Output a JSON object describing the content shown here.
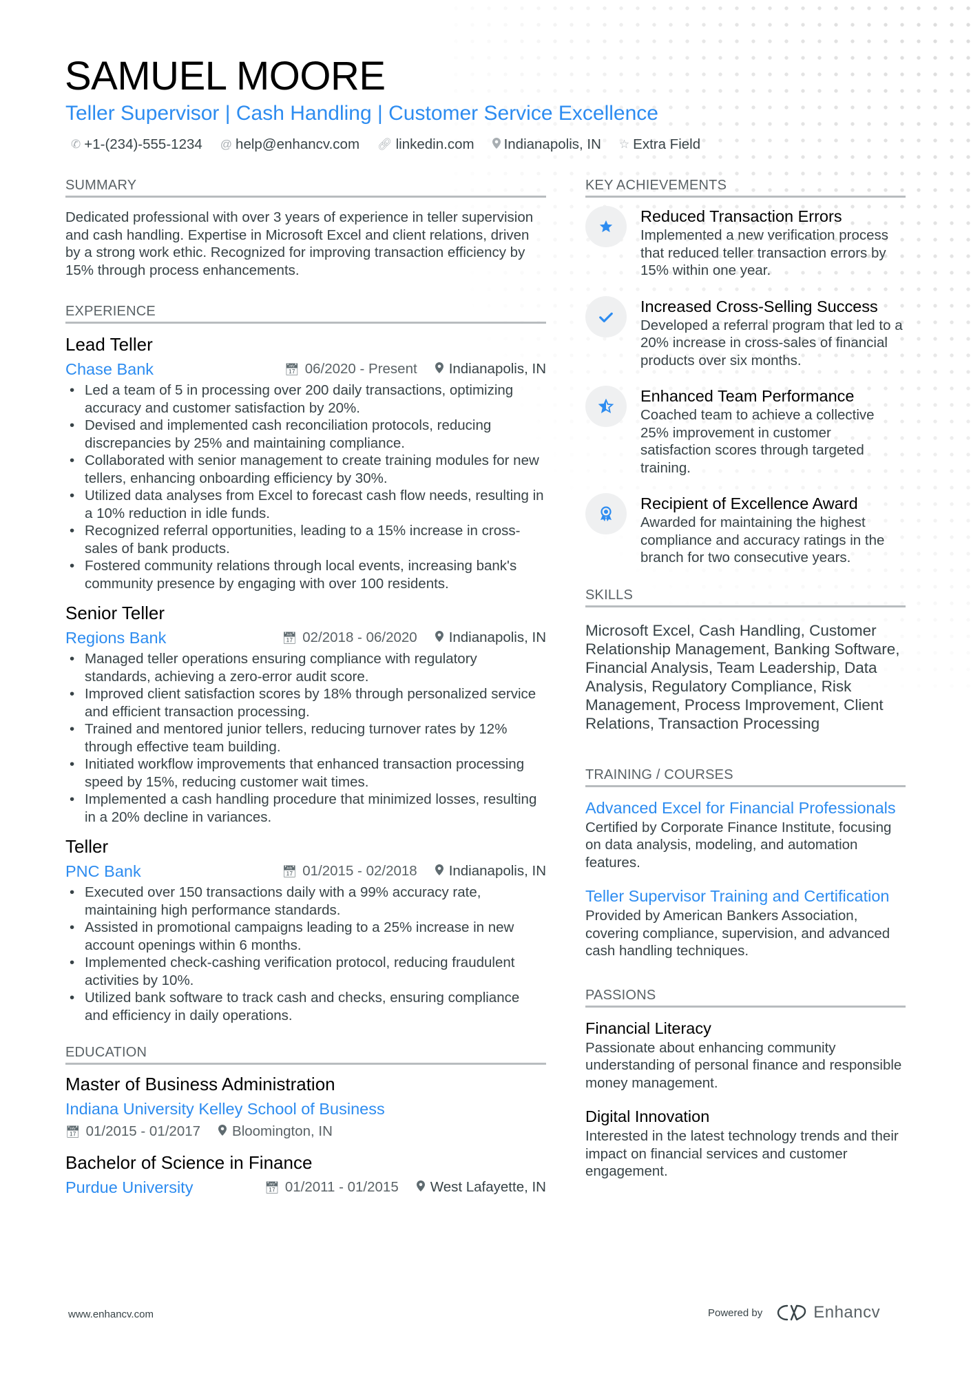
{
  "header": {
    "name": "SAMUEL MOORE",
    "title": "Teller Supervisor | Cash Handling | Customer Service Excellence",
    "contacts": [
      {
        "icon": "phone-icon",
        "text": "+1-(234)-555-1234"
      },
      {
        "icon": "at-icon",
        "text": "help@enhancv.com"
      },
      {
        "icon": "link-icon",
        "text": "linkedin.com"
      },
      {
        "icon": "location-icon",
        "text": "Indianapolis, IN"
      },
      {
        "icon": "star-icon",
        "text": "Extra Field"
      }
    ]
  },
  "summary": {
    "heading": "SUMMARY",
    "text": "Dedicated professional with over 3 years of experience in teller supervision and cash handling. Expertise in Microsoft Excel and client relations, driven by a strong work ethic. Recognized for improving transaction efficiency by 15% through process enhancements."
  },
  "experience": {
    "heading": "EXPERIENCE",
    "jobs": [
      {
        "title": "Lead Teller",
        "company": "Chase Bank",
        "dates": "06/2020 - Present",
        "location": "Indianapolis, IN",
        "bullets": [
          "Led a team of 5 in processing over 200 daily transactions, optimizing accuracy and customer satisfaction by 20%.",
          "Devised and implemented cash reconciliation protocols, reducing discrepancies by 25% and maintaining compliance.",
          "Collaborated with senior management to create training modules for new tellers, enhancing onboarding efficiency by 30%.",
          "Utilized data analyses from Excel to forecast cash flow needs, resulting in a 10% reduction in idle funds.",
          "Recognized referral opportunities, leading to a 15% increase in cross-sales of bank products.",
          "Fostered community relations through local events, increasing bank's community presence by engaging with over 100 residents."
        ]
      },
      {
        "title": "Senior Teller",
        "company": "Regions Bank",
        "dates": "02/2018 - 06/2020",
        "location": "Indianapolis, IN",
        "bullets": [
          "Managed teller operations ensuring compliance with regulatory standards, achieving a zero-error audit score.",
          "Improved client satisfaction scores by 18% through personalized service and efficient transaction processing.",
          "Trained and mentored junior tellers, reducing turnover rates by 12% through effective team building.",
          "Initiated workflow improvements that enhanced transaction processing speed by 15%, reducing customer wait times.",
          "Implemented a cash handling procedure that minimized losses, resulting in a 20% decline in variances."
        ]
      },
      {
        "title": "Teller",
        "company": "PNC Bank",
        "dates": "01/2015 - 02/2018",
        "location": "Indianapolis, IN",
        "bullets": [
          "Executed over 150 transactions daily with a 99% accuracy rate, maintaining high performance standards.",
          "Assisted in promotional campaigns leading to a 25% increase in new account openings within 6 months.",
          "Implemented check-cashing verification protocol, reducing fraudulent activities by 10%.",
          "Utilized bank software to track cash and checks, ensuring compliance and efficiency in daily operations."
        ]
      }
    ]
  },
  "education": {
    "heading": "EDUCATION",
    "items": [
      {
        "degree": "Master of Business Administration",
        "school": "Indiana University Kelley School of Business",
        "dates": "01/2015 - 01/2017",
        "location": "Bloomington, IN"
      },
      {
        "degree": "Bachelor of Science in Finance",
        "school": "Purdue University",
        "dates": "01/2011 - 01/2015",
        "location": "West Lafayette, IN"
      }
    ]
  },
  "achievements": {
    "heading": "KEY ACHIEVEMENTS",
    "items": [
      {
        "icon": "star-icon",
        "title": "Reduced Transaction Errors",
        "desc": "Implemented a new verification process that reduced teller transaction errors by 15% within one year."
      },
      {
        "icon": "check-icon",
        "title": "Increased Cross-Selling Success",
        "desc": "Developed a referral program that led to a 20% increase in cross-sales of financial products over six months."
      },
      {
        "icon": "half-star-icon",
        "title": "Enhanced Team Performance",
        "desc": "Coached team to achieve a collective 25% improvement in customer satisfaction scores through targeted training."
      },
      {
        "icon": "award-ribbon-icon",
        "title": "Recipient of Excellence Award",
        "desc": "Awarded for maintaining the highest compliance and accuracy ratings in the branch for two consecutive years."
      }
    ]
  },
  "skills": {
    "heading": "SKILLS",
    "text": "Microsoft Excel, Cash Handling, Customer Relationship Management, Banking Software, Financial Analysis, Team Leadership, Data Analysis, Regulatory Compliance, Risk Management, Process Improvement, Client Relations, Transaction Processing"
  },
  "training": {
    "heading": "TRAINING / COURSES",
    "items": [
      {
        "title": "Advanced Excel for Financial Professionals",
        "desc": "Certified by Corporate Finance Institute, focusing on data analysis, modeling, and automation features."
      },
      {
        "title": "Teller Supervisor Training and Certification",
        "desc": "Provided by American Bankers Association, covering compliance, supervision, and advanced cash handling techniques."
      }
    ]
  },
  "passions": {
    "heading": "PASSIONS",
    "items": [
      {
        "title": "Financial Literacy",
        "desc": "Passionate about enhancing community understanding of personal finance and responsible money management."
      },
      {
        "title": "Digital Innovation",
        "desc": "Interested in the latest technology trends and their impact on financial services and customer engagement."
      }
    ]
  },
  "footer": {
    "website": "www.enhancv.com",
    "powered_by": "Powered by",
    "brand": "Enhancv"
  },
  "colors": {
    "accent": "#2d8cf0",
    "text": "#384347",
    "heading_rule": "#b8bcbf"
  }
}
